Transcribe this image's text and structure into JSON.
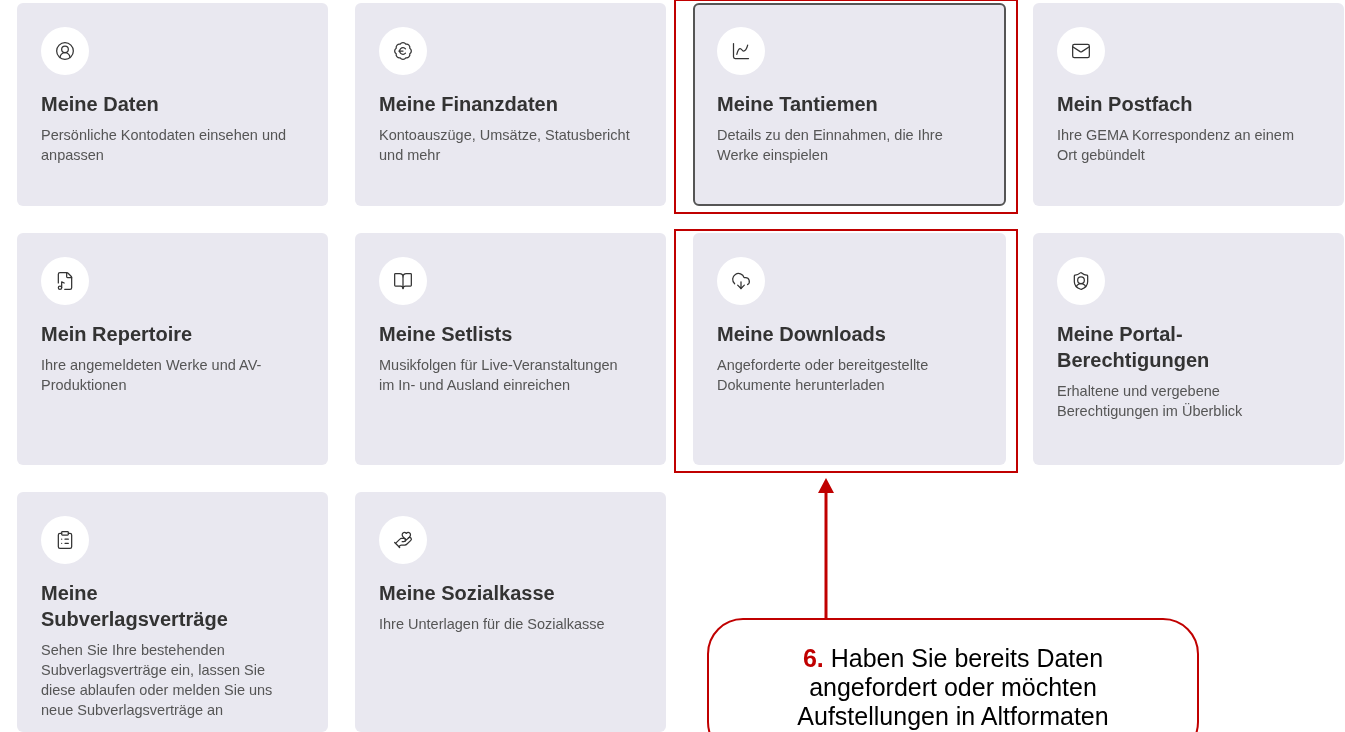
{
  "cards": [
    {
      "title": "Meine Daten",
      "description": "Persönliche Kontodaten einsehen und anpassen",
      "selected": false,
      "annotated": false
    },
    {
      "title": "Meine Finanzdaten",
      "description": "Kontoauszüge, Umsätze, Statusbericht und mehr",
      "selected": false,
      "annotated": false
    },
    {
      "title": "Meine Tantiemen",
      "description": "Details zu den Einnahmen, die Ihre Werke einspielen",
      "selected": true,
      "annotated": true
    },
    {
      "title": "Mein Postfach",
      "description": "Ihre GEMA Korrespondenz an einem Ort gebündelt",
      "selected": false,
      "annotated": false
    },
    {
      "title": "Mein Repertoire",
      "description": "Ihre angemeldeten Werke und AV-Produktionen",
      "selected": false,
      "annotated": false
    },
    {
      "title": "Meine Setlists",
      "description": "Musikfolgen für Live-Veranstaltungen im In- und Ausland einreichen",
      "selected": false,
      "annotated": false
    },
    {
      "title": "Meine Downloads",
      "description": "Angeforderte oder bereitgestellte Dokumente herunterladen",
      "selected": false,
      "annotated": true
    },
    {
      "title": "Meine Portal-Berechtigungen",
      "description": "Erhaltene und vergebene Berechtigungen im Überblick",
      "selected": false,
      "annotated": false
    },
    {
      "title": "Meine Subverlagsverträge",
      "description": "Sehen Sie Ihre bestehenden Subverlagsverträge ein, lassen Sie diese ablaufen oder melden Sie uns neue Subverlagsverträge an",
      "selected": false,
      "annotated": false
    },
    {
      "title": "Meine Sozialkasse",
      "description": "Ihre Unterlagen für die Sozialkasse",
      "selected": false,
      "annotated": false
    }
  ],
  "callout": {
    "number": "6.",
    "text": "Haben Sie bereits Daten angefordert oder möchten Aufstellungen in Altformaten"
  }
}
